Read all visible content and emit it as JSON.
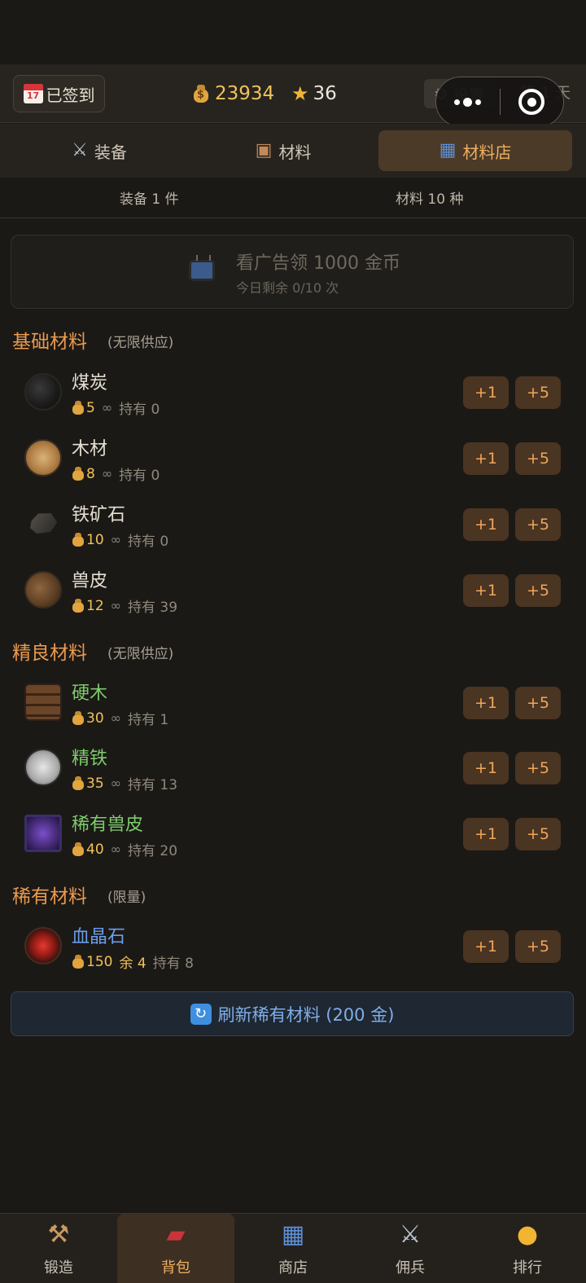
{
  "header": {
    "signin_label": "已签到",
    "calendar_icon_text": "17",
    "gold": "23934",
    "stars": "36",
    "settings_label": "设置",
    "day_label": "第 1 天"
  },
  "tabs": [
    {
      "label": "装备",
      "icon": "crossed-swords-icon"
    },
    {
      "label": "材料",
      "icon": "box-icon"
    },
    {
      "label": "材料店",
      "icon": "shop-icon",
      "active": true
    }
  ],
  "counts": {
    "equipment": "装备 1 件",
    "materials": "材料 10 种"
  },
  "ad": {
    "title": "看广告领 1000 金币",
    "subtitle": "今日剩余 0/10 次"
  },
  "sections": {
    "basic": {
      "title": "基础材料",
      "note": "(无限供应)"
    },
    "fine": {
      "title": "精良材料",
      "note": "(无限供应)"
    },
    "rare": {
      "title": "稀有材料",
      "note": "(限量)"
    }
  },
  "items": [
    {
      "name": "煤炭",
      "price": "5",
      "stock": "∞",
      "held": "持有 0"
    },
    {
      "name": "木材",
      "price": "8",
      "stock": "∞",
      "held": "持有 0"
    },
    {
      "name": "铁矿石",
      "price": "10",
      "stock": "∞",
      "held": "持有 0"
    },
    {
      "name": "兽皮",
      "price": "12",
      "stock": "∞",
      "held": "持有 39"
    },
    {
      "name": "硬木",
      "price": "30",
      "stock": "∞",
      "held": "持有 1"
    },
    {
      "name": "精铁",
      "price": "35",
      "stock": "∞",
      "held": "持有 13"
    },
    {
      "name": "稀有兽皮",
      "price": "40",
      "stock": "∞",
      "held": "持有 20"
    },
    {
      "name": "血晶石",
      "price": "150",
      "stock": "余 4",
      "held": "持有 8"
    }
  ],
  "buttons": {
    "plus1": "+1",
    "plus5": "+5"
  },
  "refresh_label": "刷新稀有材料 (200 金)",
  "nav": [
    {
      "label": "锻造",
      "icon": "hammer-icon"
    },
    {
      "label": "背包",
      "icon": "backpack-icon",
      "active": true
    },
    {
      "label": "商店",
      "icon": "shop-icon"
    },
    {
      "label": "佣兵",
      "icon": "crossed-swords-icon"
    },
    {
      "label": "排行",
      "icon": "medal-icon"
    }
  ],
  "colors": {
    "accent": "#ec9a4e",
    "gold": "#f1c25a",
    "good_item": "#7dcb6c",
    "rare_item": "#6b9dec",
    "button_bg": "#4a3422"
  }
}
